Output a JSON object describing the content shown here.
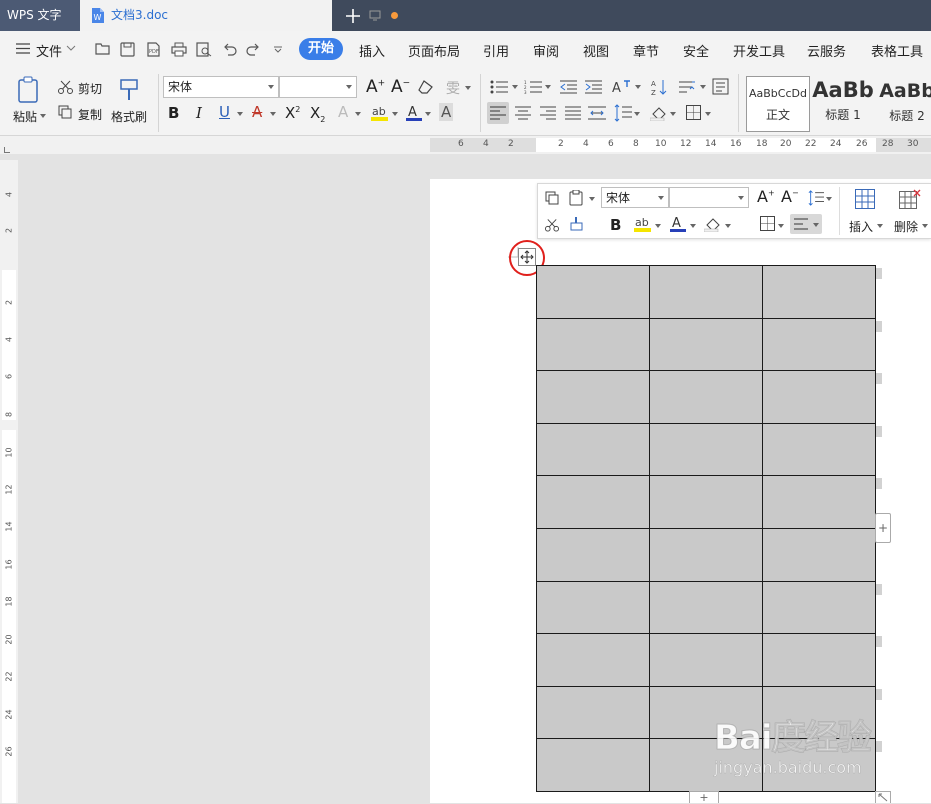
{
  "titlebar": {
    "app_name": "WPS 文字",
    "doc_tab_label": "文档3.doc",
    "new_tab_symbol": "+",
    "unsaved_dot_color": "#f79a3c"
  },
  "menu": {
    "file_label": "文件",
    "tabs": [
      "开始",
      "插入",
      "页面布局",
      "引用",
      "审阅",
      "视图",
      "章节",
      "安全",
      "开发工具",
      "云服务",
      "表格工具"
    ],
    "active_tab": "开始",
    "active_color": "#3a7ee8"
  },
  "ribbon": {
    "paste_label": "粘贴",
    "cut_label": "剪切",
    "copy_label": "复制",
    "format_painter_label": "格式刷",
    "font_name": "宋体",
    "font_size": "",
    "bold": "B",
    "italic": "I",
    "underline": "U",
    "styles": [
      {
        "sample": "AaBbCcDd",
        "name": "正文"
      },
      {
        "sample": "AaBb",
        "name": "标题 1"
      },
      {
        "sample": "AaBb",
        "name": "标题 2"
      }
    ]
  },
  "ruler": {
    "top_numbers": [
      "6",
      "4",
      "2",
      "2",
      "4",
      "6",
      "8",
      "10",
      "12",
      "14",
      "16",
      "18",
      "20",
      "22",
      "24",
      "26",
      "28",
      "30"
    ],
    "left_numbers": [
      "4",
      "2",
      "2",
      "4",
      "6",
      "8",
      "10",
      "12",
      "14",
      "16",
      "18",
      "20",
      "22",
      "24",
      "26"
    ]
  },
  "float_toolbar": {
    "font_name": "宋体",
    "font_size": "",
    "bold": "B",
    "insert_label": "插入",
    "delete_label": "删除"
  },
  "table": {
    "rows": 10,
    "cols": 3,
    "cell_fill": "#c9c9c9",
    "add_symbol": "+"
  },
  "watermark": {
    "logo_text": "Bai度经验",
    "url": "jingyan.baidu.com"
  }
}
